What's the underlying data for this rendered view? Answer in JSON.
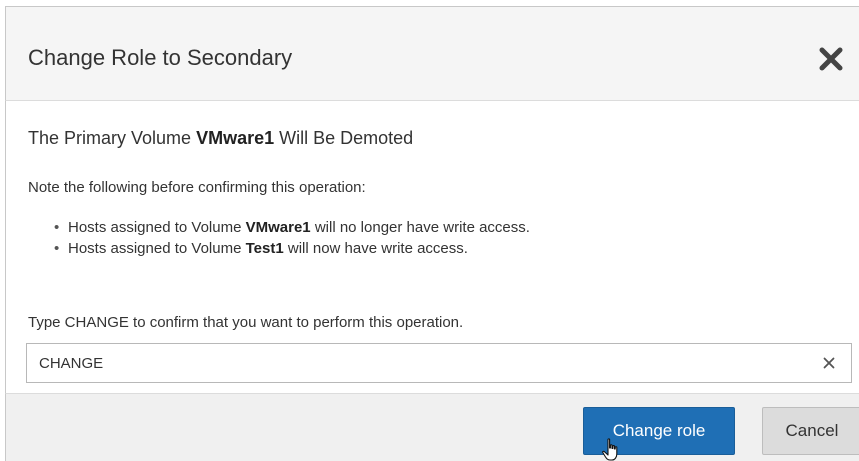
{
  "dialog": {
    "title": "Change Role to Secondary",
    "close_icon": "close-icon"
  },
  "body": {
    "subtitle_prefix": "The Primary Volume",
    "subtitle_volume": "VMware1",
    "subtitle_suffix": "Will Be Demoted",
    "note": "Note the following before confirming this operation:",
    "bullets": [
      {
        "prefix": "Hosts assigned to Volume",
        "volume": "VMware1",
        "suffix": "will no longer have write access."
      },
      {
        "prefix": "Hosts assigned to Volume",
        "volume": "Test1",
        "suffix": "will now have write access."
      }
    ],
    "confirm_label": "Type CHANGE to confirm that you want to perform this operation.",
    "confirm_value": "CHANGE",
    "clear_icon": "clear-icon"
  },
  "footer": {
    "primary_label": "Change role",
    "secondary_label": "Cancel"
  },
  "colors": {
    "primary_button": "#1f6fb5",
    "header_bg": "#f5f5f5",
    "footer_bg": "#f0f0f0"
  }
}
